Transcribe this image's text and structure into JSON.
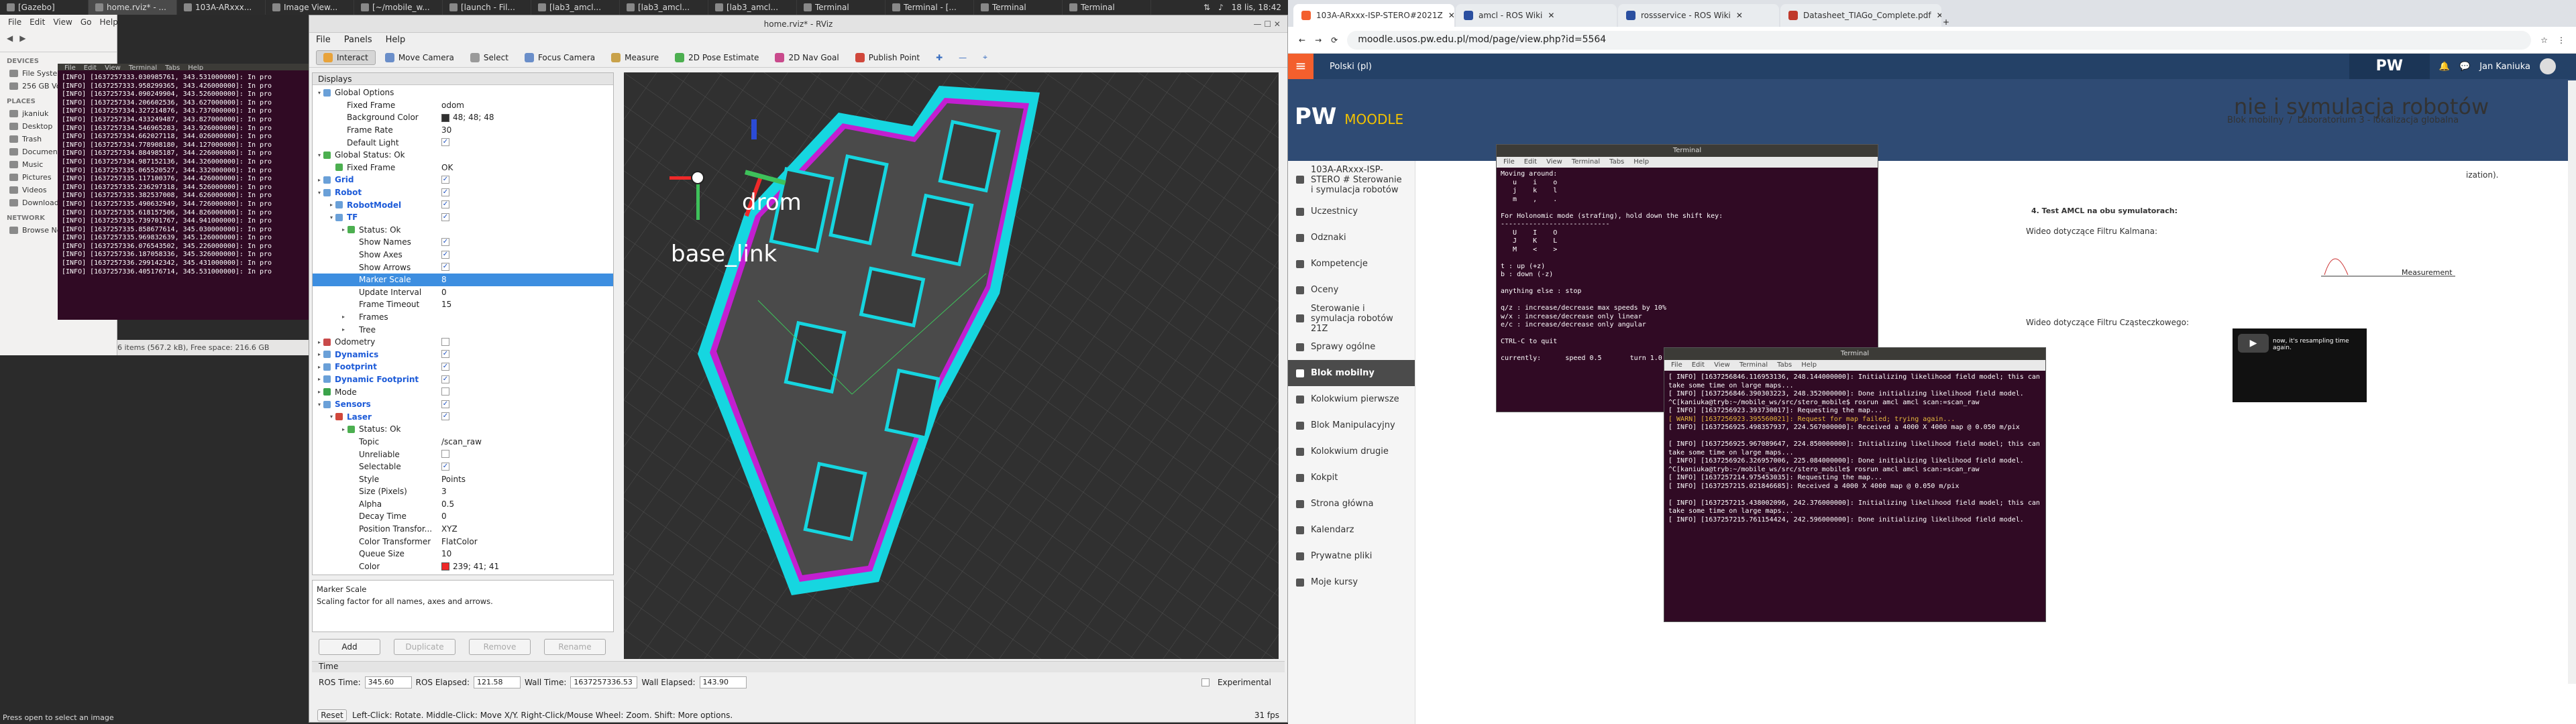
{
  "topbar": {
    "tasks": [
      "[Gazebo]",
      "home.rviz* - ...",
      "103A-ARxxx...",
      "Image View...",
      "[~/mobile_w...",
      "[launch - Fil...",
      "[lab3_amcl...",
      "[lab3_amcl...",
      "[lab3_amcl...",
      "Terminal",
      "Terminal - [...",
      "Terminal",
      "Terminal"
    ],
    "clock": "18 lis, 18:42"
  },
  "file_manager": {
    "menu": [
      "File",
      "Edit",
      "View",
      "Go",
      "Help"
    ],
    "devices_title": "DEVICES",
    "devices": [
      "File System",
      "256 GB Volume"
    ],
    "places_title": "PLACES",
    "places": [
      "jkaniuk",
      "Desktop",
      "Trash",
      "Documents",
      "Music",
      "Pictures",
      "Videos",
      "Downloads"
    ],
    "network_title": "NETWORK",
    "network": [
      "Browse Network"
    ],
    "status": "6 items (567.2 kB), Free space: 216.6 GB",
    "bottom_hint": "Press open to select an image"
  },
  "left_terminal": {
    "menu": [
      "File",
      "Edit",
      "View",
      "Terminal",
      "Tabs",
      "Help"
    ],
    "lines": [
      "[INFO] [1637257333.030985761, 343.531000000]: In pro",
      "[INFO] [1637257333.958299365, 343.426000000]: In pro",
      "[INFO] [1637257334.090249904, 343.526000000]: In pro",
      "[INFO] [1637257334.206602536, 343.627000000]: In pro",
      "[INFO] [1637257334.327214876, 343.737000000]: In pro",
      "[INFO] [1637257334.433249487, 343.827000000]: In pro",
      "[INFO] [1637257334.546965283, 343.926000000]: In pro",
      "[INFO] [1637257334.662027118, 344.026000000]: In pro",
      "[INFO] [1637257334.778908180, 344.127000000]: In pro",
      "[INFO] [1637257334.884985187, 344.226000000]: In pro",
      "[INFO] [1637257334.987152136, 344.326000000]: In pro",
      "[INFO] [1637257335.065520527, 344.332000000]: In pro",
      "[INFO] [1637257335.117100376, 344.426000000]: In pro",
      "[INFO] [1637257335.236297318, 344.526000000]: In pro",
      "[INFO] [1637257335.382537008, 344.626000000]: In pro",
      "[INFO] [1637257335.490632949, 344.726000000]: In pro",
      "[INFO] [1637257335.618157506, 344.826000000]: In pro",
      "[INFO] [1637257335.739701767, 344.941000000]: In pro",
      "[INFO] [1637257335.858677614, 345.030000000]: In pro",
      "[INFO] [1637257335.969832639, 345.126000000]: In pro",
      "[INFO] [1637257336.076543502, 345.226000000]: In pro",
      "[INFO] [1637257336.187058336, 345.326000000]: In pro",
      "[INFO] [1637257336.299142342, 345.431000000]: In pro",
      "[INFO] [1637257336.405176714, 345.531000000]: In pro"
    ]
  },
  "rviz": {
    "title": "home.rviz* - RViz",
    "menu": [
      "File",
      "Panels",
      "Help"
    ],
    "tools": [
      {
        "label": "Interact",
        "icon": "interact-icon",
        "color": "#e8a33b"
      },
      {
        "label": "Move Camera",
        "icon": "move-camera-icon",
        "color": "#6a8ec9"
      },
      {
        "label": "Select",
        "icon": "select-icon",
        "color": "#9a9a9a"
      },
      {
        "label": "Focus Camera",
        "icon": "focus-camera-icon",
        "color": "#6a8ec9"
      },
      {
        "label": "Measure",
        "icon": "measure-icon",
        "color": "#c9a24a"
      },
      {
        "label": "2D Pose Estimate",
        "icon": "pose-estimate-arrow-icon",
        "color": "#4caf50"
      },
      {
        "label": "2D Nav Goal",
        "icon": "nav-goal-arrow-icon",
        "color": "#c94a8c"
      },
      {
        "label": "Publish Point",
        "icon": "publish-point-icon",
        "color": "#d0473b"
      }
    ],
    "displays_title": "Displays",
    "tree": [
      {
        "d": 0,
        "arrow": "▾",
        "label": "Global Options",
        "icon": "#6aa0d8"
      },
      {
        "d": 1,
        "label": "Fixed Frame",
        "value": "odom"
      },
      {
        "d": 1,
        "label": "Background Color",
        "value": "48; 48; 48",
        "swatch": "#303030"
      },
      {
        "d": 1,
        "label": "Frame Rate",
        "value": "30"
      },
      {
        "d": 1,
        "label": "Default Light",
        "check": "✓"
      },
      {
        "d": 0,
        "arrow": "▾",
        "label": "Global Status: Ok",
        "icon": "#4caf50"
      },
      {
        "d": 1,
        "label": "Fixed Frame",
        "value": "OK",
        "icon": "#4caf50"
      },
      {
        "d": 0,
        "arrow": "▸",
        "label": "Grid",
        "icon": "#6aa0d8",
        "blue": true,
        "check": "✓"
      },
      {
        "d": 0,
        "arrow": "▾",
        "label": "Robot",
        "icon": "#6aa0d8",
        "blue": true,
        "check": "✓"
      },
      {
        "d": 1,
        "arrow": "▸",
        "label": "RobotModel",
        "icon": "#6aa0d8",
        "blue": true,
        "check": "✓"
      },
      {
        "d": 1,
        "arrow": "▾",
        "label": "TF",
        "icon": "#6aa0d8",
        "blue": true,
        "check": "✓"
      },
      {
        "d": 2,
        "arrow": "▸",
        "label": "Status: Ok",
        "icon": "#4caf50"
      },
      {
        "d": 2,
        "label": "Show Names",
        "check": "✓"
      },
      {
        "d": 2,
        "label": "Show Axes",
        "check": "✓"
      },
      {
        "d": 2,
        "label": "Show Arrows",
        "check": "✓"
      },
      {
        "d": 2,
        "label": "Marker Scale",
        "value": "8",
        "sel": true
      },
      {
        "d": 2,
        "label": "Update Interval",
        "value": "0"
      },
      {
        "d": 2,
        "label": "Frame Timeout",
        "value": "15"
      },
      {
        "d": 2,
        "arrow": "▸",
        "label": "Frames"
      },
      {
        "d": 2,
        "arrow": "▸",
        "label": "Tree"
      },
      {
        "d": 0,
        "arrow": "▸",
        "label": "Odometry",
        "icon": "#c94a4a",
        "check": " "
      },
      {
        "d": 0,
        "arrow": "▸",
        "label": "Dynamics",
        "icon": "#6aa0d8",
        "blue": true,
        "check": "✓"
      },
      {
        "d": 0,
        "arrow": "▸",
        "label": "Footprint",
        "icon": "#6aa0d8",
        "blue": true,
        "check": "✓"
      },
      {
        "d": 0,
        "arrow": "▸",
        "label": "Dynamic Footprint",
        "icon": "#6aa0d8",
        "blue": true,
        "check": "✓"
      },
      {
        "d": 0,
        "arrow": "▸",
        "label": "Mode",
        "icon": "#3aa34a",
        "check": " "
      },
      {
        "d": 0,
        "arrow": "▾",
        "label": "Sensors",
        "icon": "#6aa0d8",
        "blue": true,
        "check": "✓"
      },
      {
        "d": 1,
        "arrow": "▾",
        "label": "Laser",
        "icon": "#d0473b",
        "blue": true,
        "check": "✓"
      },
      {
        "d": 2,
        "arrow": "▸",
        "label": "Status: Ok",
        "icon": "#4caf50"
      },
      {
        "d": 2,
        "label": "Topic",
        "value": "/scan_raw"
      },
      {
        "d": 2,
        "label": "Unreliable",
        "check": " "
      },
      {
        "d": 2,
        "label": "Selectable",
        "check": "✓"
      },
      {
        "d": 2,
        "label": "Style",
        "value": "Points"
      },
      {
        "d": 2,
        "label": "Size (Pixels)",
        "value": "3"
      },
      {
        "d": 2,
        "label": "Alpha",
        "value": "0.5"
      },
      {
        "d": 2,
        "label": "Decay Time",
        "value": "0"
      },
      {
        "d": 2,
        "label": "Position Transfor...",
        "value": "XYZ"
      },
      {
        "d": 2,
        "label": "Color Transformer",
        "value": "FlatColor"
      },
      {
        "d": 2,
        "label": "Queue Size",
        "value": "10"
      },
      {
        "d": 2,
        "label": "Color",
        "value": "239; 41; 41",
        "swatch": "#ef2929"
      }
    ],
    "desc_title": "Marker Scale",
    "desc_text": "Scaling factor for all names, axes and arrows.",
    "buttons": [
      "Add",
      "Duplicate",
      "Remove",
      "Rename"
    ],
    "time_title": "Time",
    "ros_time_label": "ROS Time:",
    "ros_time": "345.60",
    "ros_elapsed_label": "ROS Elapsed:",
    "ros_elapsed": "121.58",
    "wall_time_label": "Wall Time:",
    "wall_time": "1637257336.53",
    "wall_elapsed_label": "Wall Elapsed:",
    "wall_elapsed": "143.90",
    "experimental": "Experimental",
    "reset": "Reset",
    "status": "Left-Click: Rotate. Middle-Click: Move X/Y. Right-Click/Mouse Wheel: Zoom. Shift: More options.",
    "fps": "31 fps",
    "frame_labels": [
      "drom",
      "base_link"
    ]
  },
  "browser": {
    "tabs": [
      {
        "label": "103A-ARxxx-ISP-STERO#2021Z",
        "color": "#f35f2d"
      },
      {
        "label": "amcl - ROS Wiki",
        "color": "#2a4fa0"
      },
      {
        "label": "rossservice - ROS Wiki",
        "color": "#2a4fa0"
      },
      {
        "label": "Datasheet_TIAGo_Complete.pdf",
        "color": "#c0392b"
      }
    ],
    "url": "moodle.usos.pw.edu.pl/mod/page/view.php?id=5564",
    "lang": "Polski (pl)",
    "user": "Jan Kaniuka",
    "logo_text": "MOODLE",
    "course_title": "nie i symulacja robotów",
    "breadcrumb": [
      "Blok mobilny",
      "Laboratorium 3 - lokalizacja globalna"
    ],
    "sidebar": [
      {
        "label": "103A-ARxxx-ISP-STERO # Sterowanie i symulacja robotów"
      },
      {
        "label": "Uczestnicy"
      },
      {
        "label": "Odznaki"
      },
      {
        "label": "Kompetencje"
      },
      {
        "label": "Oceny"
      },
      {
        "label": "Sterowanie i symulacja robotów 21Z"
      },
      {
        "label": "Sprawy ogólne"
      },
      {
        "label": "Blok mobilny",
        "active": true
      },
      {
        "label": "Kolokwium pierwsze"
      },
      {
        "label": "Blok Manipulacyjny"
      },
      {
        "label": "Kolokwium drugie"
      },
      {
        "label": "Kokpit"
      },
      {
        "label": "Strona główna"
      },
      {
        "label": "Kalendarz"
      },
      {
        "label": "Prywatne pliki"
      },
      {
        "label": "Moje kursy"
      }
    ],
    "content_items": [
      "4. Test AMCL na obu symulatorach:",
      "Wideo dotyczące Filtru Kalmana:",
      "Wideo dotyczące Filtru Cząsteczkowego:"
    ],
    "snippet": "ization).",
    "chart_label": "Measurement",
    "video_caption": "now, it's resampling time again."
  },
  "term_upper": {
    "title": "Terminal",
    "menu": [
      "File",
      "Edit",
      "View",
      "Terminal",
      "Tabs",
      "Help"
    ],
    "lines": [
      "Moving around:",
      "   u    i    o",
      "   j    k    l",
      "   m    ,    .",
      "",
      "For Holonomic mode (strafing), hold down the shift key:",
      "---------------------------",
      "   U    I    O",
      "   J    K    L",
      "   M    <    >",
      "",
      "t : up (+z)",
      "b : down (-z)",
      "",
      "anything else : stop",
      "",
      "q/z : increase/decrease max speeds by 10%",
      "w/x : increase/decrease only linear",
      "e/c : increase/decrease only angular",
      "",
      "CTRL-C to quit",
      "",
      "currently:      speed 0.5       turn 1.0"
    ]
  },
  "term_lower": {
    "title": "Terminal",
    "menu": [
      "File",
      "Edit",
      "View",
      "Terminal",
      "Tabs",
      "Help"
    ],
    "lines": [
      {
        "t": "[ INFO] [1637256846.116953136, 248.144000000]: Initializing likelihood field model; this can take some time on large maps..."
      },
      {
        "t": "[ INFO] [1637256846.390303223, 248.352000000]: Done initializing likelihood field model."
      },
      {
        "t": "^C[kaniuka@tryb:~/mobile_ws/src/stero_mobile$ rosrun amcl amcl scan:=scan_raw"
      },
      {
        "t": "[ INFO] [1637256923.393730017]: Requesting the map..."
      },
      {
        "t": "[ WARN] [1637256923.395560021]: Request for map failed; trying again...",
        "warn": true
      },
      {
        "t": "[ INFO] [1637256925.498357937, 224.567000000]: Received a 4000 X 4000 map @ 0.050 m/pix"
      },
      {
        "t": ""
      },
      {
        "t": "[ INFO] [1637256925.967089647, 224.850000000]: Initializing likelihood field model; this can take some time on large maps..."
      },
      {
        "t": "[ INFO] [1637256926.326957006, 225.084000000]: Done initializing likelihood field model."
      },
      {
        "t": "^C[kaniuka@tryb:~/mobile_ws/src/stero_mobile$ rosrun amcl amcl scan:=scan_raw"
      },
      {
        "t": "[ INFO] [1637257214.975453035]: Requesting the map..."
      },
      {
        "t": "[ INFO] [1637257215.021846685]: Received a 4000 X 4000 map @ 0.050 m/pix"
      },
      {
        "t": ""
      },
      {
        "t": "[ INFO] [1637257215.438002096, 242.376000000]: Initializing likelihood field model; this can take some time on large maps..."
      },
      {
        "t": "[ INFO] [1637257215.761154424, 242.596000000]: Done initializing likelihood field model."
      }
    ]
  }
}
